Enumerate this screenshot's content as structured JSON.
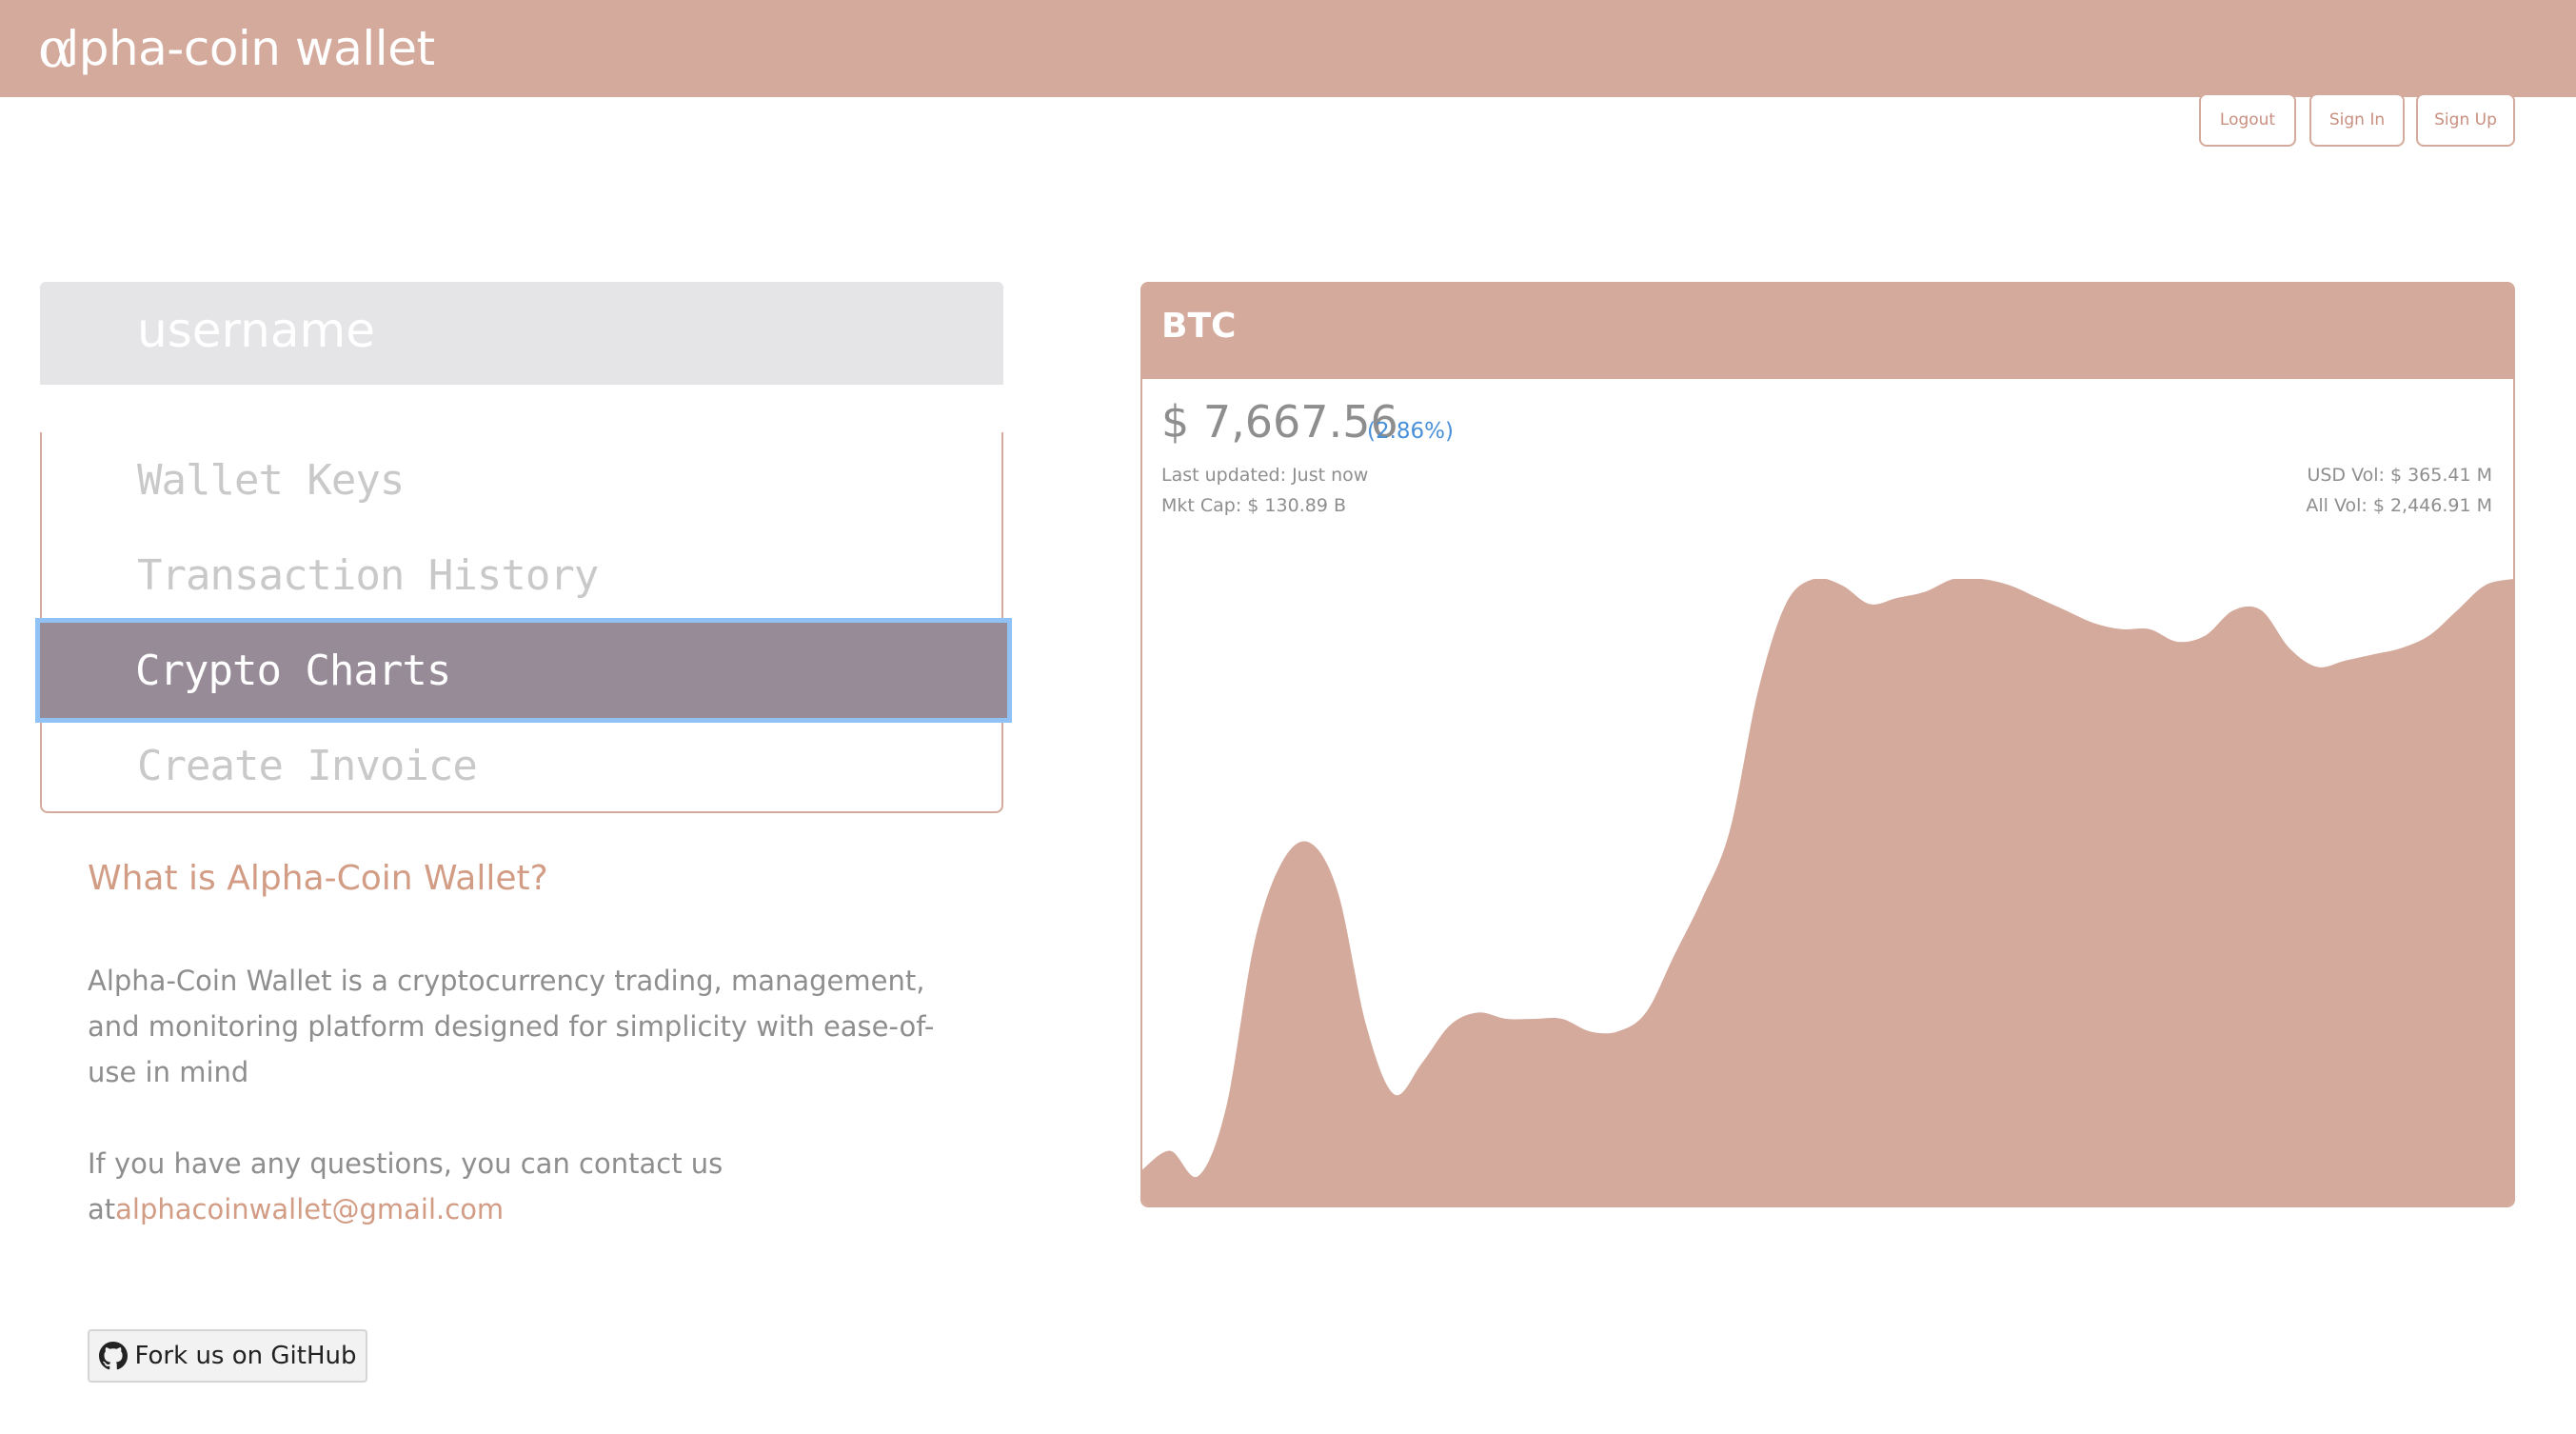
{
  "header": {
    "brand_symbol": "α",
    "brand_text": "lpha-coin wallet",
    "bg_color": "#d4aa9c"
  },
  "auth": {
    "logout": "Logout",
    "signin": "Sign In",
    "signup": "Sign Up"
  },
  "sidebar": {
    "username": "username",
    "items": [
      {
        "label": "Wallet Keys",
        "active": false
      },
      {
        "label": "Transaction History",
        "active": false
      },
      {
        "label": "Crypto Charts",
        "active": true
      },
      {
        "label": "Create Invoice",
        "active": false
      }
    ],
    "active_color": "#988b98"
  },
  "about": {
    "title": "What is Alpha-Coin Wallet?",
    "description": "Alpha-Coin Wallet is a cryptocurrency trading, management, and monitoring platform designed for simplicity with ease-of-use in mind",
    "contact_prefix": "If you have any questions, you can contact us at",
    "email": "alphacoinwallet@gmail.com"
  },
  "github": {
    "label": "Fork us on GitHub",
    "icon": "github-icon"
  },
  "coin_card": {
    "symbol": "BTC",
    "price": "$ 7,667.56",
    "change": "(2.86%)",
    "last_updated": "Last updated: Just now",
    "mkt_cap": "Mkt Cap: $ 130.89 B",
    "usd_vol": "USD Vol: $ 365.41 M",
    "all_vol": "All Vol: $ 2,446.91 M",
    "change_color": "#4a90d9"
  },
  "chart_data": {
    "type": "area",
    "color": "#d4aa9c",
    "values": [
      0.06,
      0.09,
      0.05,
      0.16,
      0.42,
      0.55,
      0.58,
      0.5,
      0.29,
      0.18,
      0.23,
      0.29,
      0.31,
      0.3,
      0.3,
      0.3,
      0.28,
      0.28,
      0.31,
      0.4,
      0.49,
      0.6,
      0.82,
      0.96,
      1.0,
      0.99,
      0.96,
      0.97,
      0.98,
      1.0,
      1.0,
      0.99,
      0.97,
      0.95,
      0.93,
      0.92,
      0.92,
      0.9,
      0.91,
      0.95,
      0.95,
      0.89,
      0.86,
      0.87,
      0.88,
      0.89,
      0.91,
      0.95,
      0.99,
      1.0
    ]
  }
}
